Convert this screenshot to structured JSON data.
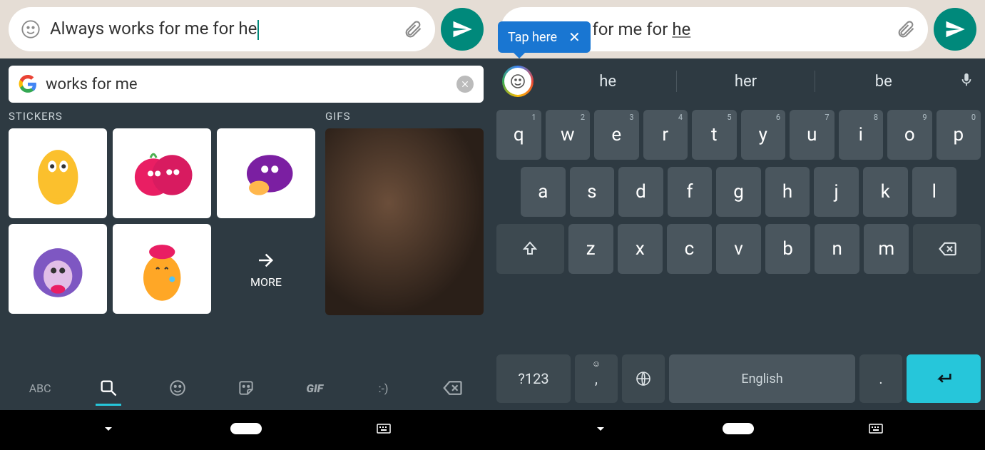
{
  "left": {
    "message_text": "Always works for me for he",
    "search_text": "works for me",
    "stickers_label": "STICKERS",
    "gifs_label": "GIFS",
    "more_label": "MORE",
    "tabs": {
      "abc": "ABC",
      "gif": "GIF",
      "smiley": ":-)"
    }
  },
  "right": {
    "message_text_prefix": "works for me for ",
    "message_text_suffix": "he",
    "tooltip": "Tap here",
    "suggestions": [
      "he",
      "her",
      "be"
    ],
    "keys": {
      "row1": [
        "q",
        "w",
        "e",
        "r",
        "t",
        "y",
        "u",
        "i",
        "o",
        "p"
      ],
      "row1_sup": [
        "1",
        "2",
        "3",
        "4",
        "5",
        "6",
        "7",
        "8",
        "9",
        "0"
      ],
      "row2": [
        "a",
        "s",
        "d",
        "f",
        "g",
        "h",
        "j",
        "k",
        "l"
      ],
      "row3": [
        "z",
        "x",
        "c",
        "v",
        "b",
        "n",
        "m"
      ]
    },
    "numbers_label": "?123",
    "space_label": "English",
    "comma": ",",
    "period": "."
  }
}
